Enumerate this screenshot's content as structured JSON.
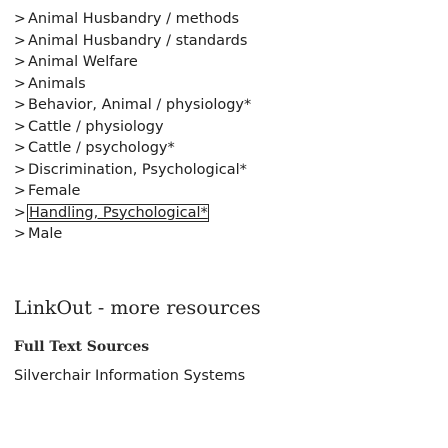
{
  "mesh_terms": [
    "Animal Husbandry / methods",
    "Animal Husbandry / standards",
    "Animal Welfare",
    "Animals",
    "Behavior, Animal / physiology*",
    "Cattle / physiology",
    "Cattle / psychology*",
    "Discrimination, Psychological*",
    "Female",
    "Handling, Psychological*",
    "Male"
  ],
  "chevron_glyph": ">",
  "linkout": {
    "title": "LinkOut - more resources",
    "full_text_heading": "Full Text Sources",
    "full_text_sources": [
      "Silverchair Information Systems"
    ]
  }
}
